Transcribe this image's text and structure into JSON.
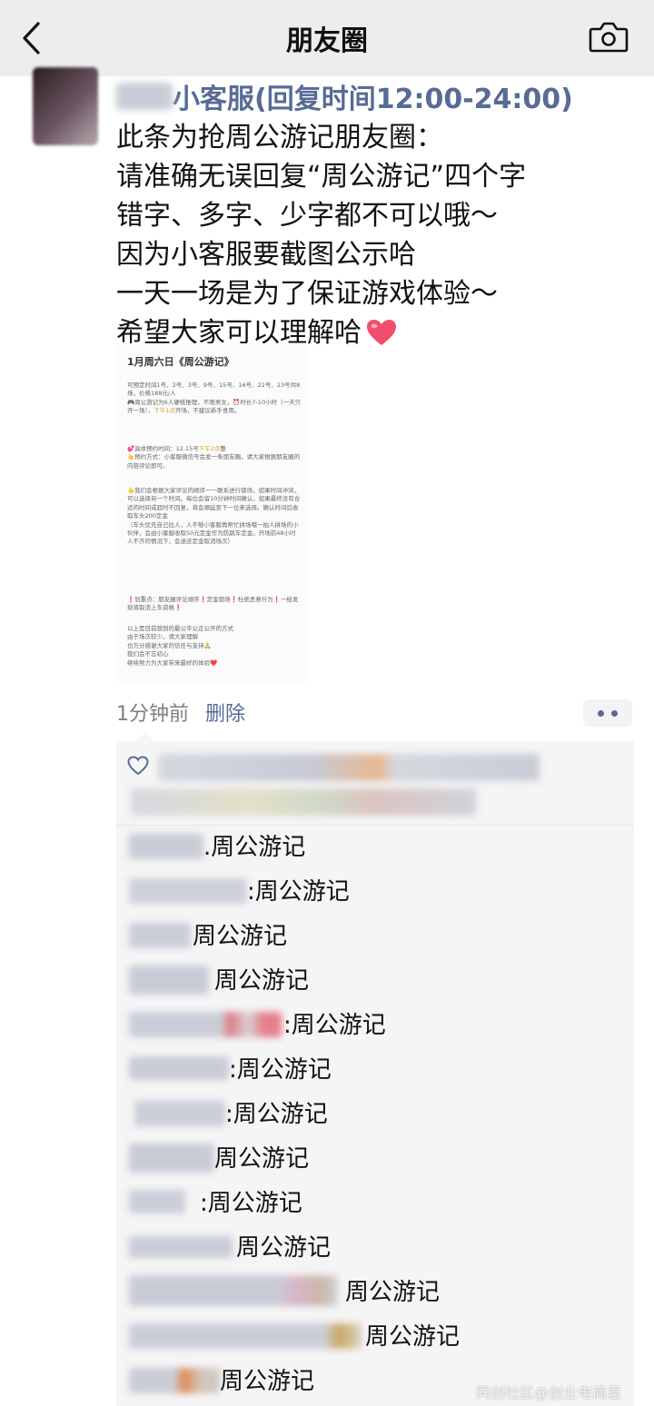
{
  "nav": {
    "title": "朋友圈"
  },
  "post": {
    "author_name": "小客服(回复时间12:00-24:00)",
    "lines": [
      "此条为抢周公游记朋友圈：",
      "请准确无误回复“周公游记”四个字",
      "错字、多字、少字都不可以哦～",
      "因为小客服要截图公示哈",
      "一天一场是为了保证游戏体验～",
      "希望大家可以理解哈"
    ],
    "emoji": "heart-emoji",
    "image": {
      "title": "1月周六日《周公游记》",
      "p1": "可预定时间1号、2号、3号、9号、15号、16号、22号、23号共8场，价格188元/人\n🎮周公游记为6人硬核推理，不限男女，⏰时长7-10小时（一天只开一场），",
      "p1_hl": "下午1点",
      "p1_end": "开场，不建议新手食用。",
      "p2": "💕具体预约时间：12.15号",
      "p2_hl": "下午2点",
      "p2_end": "整\n👆预约方式：小客服微信号会发一条朋友圈，请大家根据朋友圈的内容评论即可。",
      "p3": "👆我们会根据大家评论的顺序一一联系进行锁场，如果时间冲突，可以选择另一个时间。每位会留10分钟时间确认，如果最终没有合适的时间或超时不回复，将会顺延至下一位来选择。确认时间后收取车头200定金\n（车头优先自己拉人，人不够小客服再帮忙拼场哦一拍人拼场的小伙伴，会由小客服收取50元定金作为防跳车定金。开场前48小时人不齐的情况下，会退还定金取消场次）",
      "p4": "❗划重点：朋友圈评论顺序❗定金锁场❗杜绝恶意行为❗一经发现将取消上车资格❗",
      "p5": "以上是目前想到的最公平公正公开的方式\n由于场次较少，请大家理解\n也万分感谢大家的信任与支持🙏\n我们会不忘初心\n继续努力为大家带来最好的体验❤️"
    },
    "time_ago": "1分钟前",
    "delete_label": "删除",
    "more_icon": "more-dots-icon"
  },
  "likes": {
    "icon": "heart-outline-icon"
  },
  "comments": [
    {
      "colon": ".",
      "text": "周公游记"
    },
    {
      "colon": ":",
      "text": "周公游记"
    },
    {
      "colon": "",
      "text": "周公游记"
    },
    {
      "colon": "",
      "text": "周公游记"
    },
    {
      "colon": ":",
      "text": "周公游记"
    },
    {
      "colon": ":",
      "text": "周公游记"
    },
    {
      "colon": ":",
      "text": "周公游记"
    },
    {
      "colon": "",
      "text": "周公游记"
    },
    {
      "colon": ":",
      "text": "周公游记"
    },
    {
      "colon": "",
      "text": "周公游记"
    },
    {
      "colon": "",
      "text": "周公游记"
    },
    {
      "colon": "",
      "text": "周公游记"
    },
    {
      "colon": "",
      "text": "周公游记"
    }
  ],
  "watermark": "同创社区@创业电商君",
  "colors": {
    "nav_bg": "#ededed",
    "name_link": "#576b95",
    "meta_gray": "#7f7f7f",
    "comment_bg": "#f5f5f6",
    "heart": "#f04e6e"
  }
}
